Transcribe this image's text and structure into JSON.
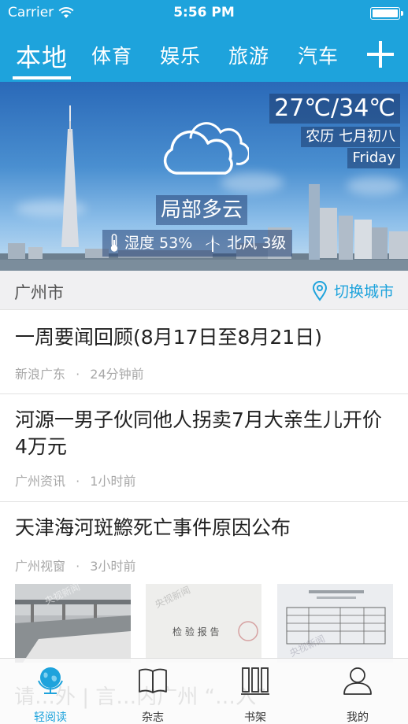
{
  "status_bar": {
    "carrier": "Carrier",
    "time": "5:56 PM"
  },
  "tabs": [
    {
      "label": "本地",
      "active": true
    },
    {
      "label": "体育",
      "active": false
    },
    {
      "label": "娱乐",
      "active": false
    },
    {
      "label": "旅游",
      "active": false
    },
    {
      "label": "汽车",
      "active": false
    }
  ],
  "weather": {
    "temperature": "27℃/34℃",
    "lunar_date": "农历 七月初八",
    "weekday": "Friday",
    "condition": "局部多云",
    "humidity": "湿度 53%",
    "wind": "北风 3级",
    "icon": "cloud-icon"
  },
  "city_bar": {
    "city": "广州市",
    "switch_label": "切换城市"
  },
  "news": [
    {
      "title": "一周要闻回顾(8月17日至8月21日)",
      "source": "新浪广东",
      "time": "24分钟前"
    },
    {
      "title": "河源一男子伙同他人拐卖7月大亲生儿开价4万元",
      "source": "广州资讯",
      "time": "1小时前"
    },
    {
      "title": "天津海河斑鰶死亡事件原因公布",
      "source": "广州视窗",
      "time": "3小时前"
    }
  ],
  "thumb_text": {
    "report": "检 验 报 告",
    "watermark": "央视新闻"
  },
  "tab_bar": {
    "items": [
      {
        "label": "轻阅读",
        "icon": "globe-icon",
        "active": true
      },
      {
        "label": "杂志",
        "icon": "book-icon",
        "active": false
      },
      {
        "label": "书架",
        "icon": "bookshelf-icon",
        "active": false
      },
      {
        "label": "我的",
        "icon": "person-icon",
        "active": false
      }
    ],
    "ghost_text": "请…外 | 言…内广州 “…入”"
  },
  "colors": {
    "accent": "#1ea3dc",
    "meta_text": "#a8a8a8"
  }
}
